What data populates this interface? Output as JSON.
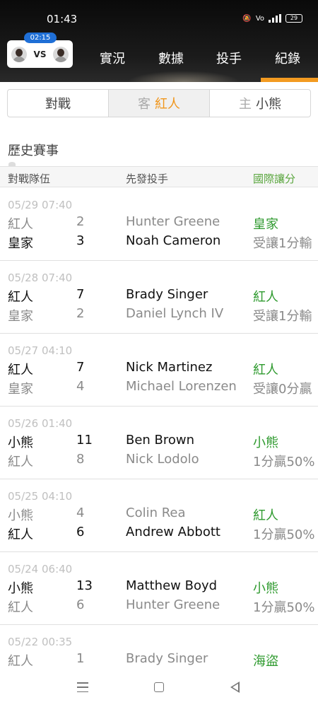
{
  "status": {
    "time": "01:43",
    "battery": "29"
  },
  "matchup": {
    "time": "02:15",
    "vs": "VS"
  },
  "nav": {
    "tabs": [
      "實況",
      "數據",
      "投手",
      "紀錄"
    ],
    "active_index": 3
  },
  "segments": [
    {
      "prefix": "",
      "label": "對戰"
    },
    {
      "prefix": "客",
      "label": "紅人"
    },
    {
      "prefix": "主",
      "label": "小熊"
    }
  ],
  "section_title": "歷史賽事",
  "columns": {
    "teams": "對戰隊伍",
    "pitcher": "先發投手",
    "handicap": "國際讓分"
  },
  "games": [
    {
      "date": "05/29 07:40",
      "row1": {
        "team": "紅人",
        "score": "2",
        "pitcher": "Hunter Greene",
        "result": "皇家"
      },
      "row2": {
        "team": "皇家",
        "score": "3",
        "pitcher": "Noah Cameron",
        "result": "受讓1分輸"
      }
    },
    {
      "date": "05/28 07:40",
      "row1": {
        "team": "紅人",
        "score": "7",
        "pitcher": "Brady Singer",
        "result": "紅人"
      },
      "row2": {
        "team": "皇家",
        "score": "2",
        "pitcher": "Daniel Lynch IV",
        "result": "受讓1分輸"
      }
    },
    {
      "date": "05/27 04:10",
      "row1": {
        "team": "紅人",
        "score": "7",
        "pitcher": "Nick Martinez",
        "result": "紅人"
      },
      "row2": {
        "team": "皇家",
        "score": "4",
        "pitcher": "Michael Lorenzen",
        "result": "受讓0分贏"
      }
    },
    {
      "date": "05/26 01:40",
      "row1": {
        "team": "小熊",
        "score": "11",
        "pitcher": "Ben Brown",
        "result": "小熊"
      },
      "row2": {
        "team": "紅人",
        "score": "8",
        "pitcher": "Nick Lodolo",
        "result": "1分贏50%"
      }
    },
    {
      "date": "05/25 04:10",
      "row1": {
        "team": "小熊",
        "score": "4",
        "pitcher": "Colin Rea",
        "result": "紅人"
      },
      "row2": {
        "team": "紅人",
        "score": "6",
        "pitcher": "Andrew Abbott",
        "result": "1分贏50%"
      }
    },
    {
      "date": "05/24 06:40",
      "row1": {
        "team": "小熊",
        "score": "13",
        "pitcher": "Matthew Boyd",
        "result": "小熊"
      },
      "row2": {
        "team": "紅人",
        "score": "6",
        "pitcher": "Hunter Greene",
        "result": "1分贏50%"
      }
    },
    {
      "date": "05/22 00:35",
      "row1": {
        "team": "紅人",
        "score": "1",
        "pitcher": "Brady Singer",
        "result": "海盜"
      },
      "row2": {
        "team": "",
        "score": "",
        "pitcher": "",
        "result": ""
      }
    }
  ],
  "colors": {
    "accent": "#f0961c",
    "win_green": "#2e9a2e",
    "header_green": "#5aa63e",
    "pill_blue": "#1f6fd6"
  }
}
